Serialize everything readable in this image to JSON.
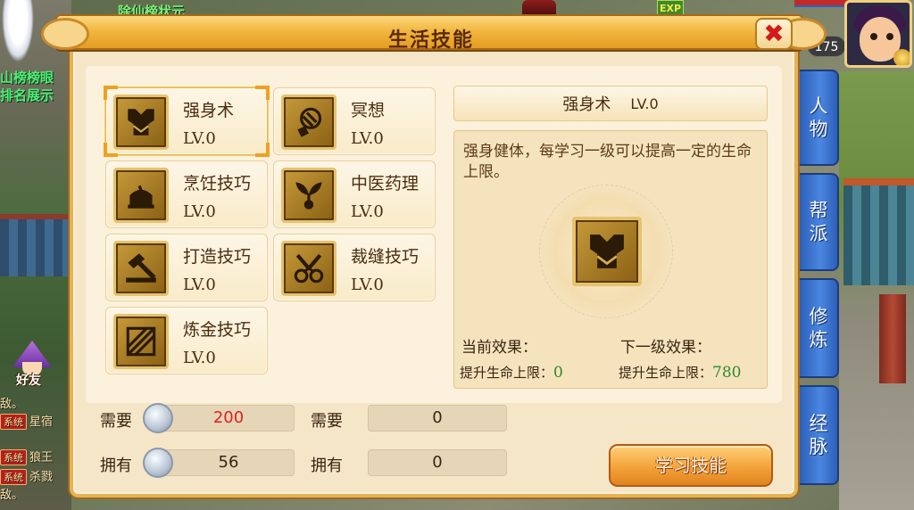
{
  "scene": {
    "top_banner": "除仙榜状元",
    "left_label_1": "山榜榜眼",
    "left_label_2": "排名展示",
    "friend_label": "好友",
    "exp_label": "EXP",
    "player_level": "175",
    "chat": [
      {
        "tag": "",
        "text": "敌。"
      },
      {
        "tag": "系统",
        "text": "星宿"
      },
      {
        "tag": "系统",
        "text": "狼王"
      },
      {
        "tag": "系统",
        "text": "杀戮"
      },
      {
        "tag": "",
        "text": "敌。"
      }
    ]
  },
  "side_tabs": [
    {
      "label": "人物"
    },
    {
      "label": "帮派"
    },
    {
      "label": "修炼"
    },
    {
      "label": "经脉"
    }
  ],
  "dialog": {
    "title": "生活技能",
    "close_label": "✖"
  },
  "skills": [
    {
      "name": "强身术",
      "level": "LV.0",
      "icon": "armor-icon",
      "selected": true
    },
    {
      "name": "冥想",
      "level": "LV.0",
      "icon": "meditation-icon",
      "selected": false
    },
    {
      "name": "烹饪技巧",
      "level": "LV.0",
      "icon": "cooking-icon",
      "selected": false
    },
    {
      "name": "中医药理",
      "level": "LV.0",
      "icon": "herb-icon",
      "selected": false
    },
    {
      "name": "打造技巧",
      "level": "LV.0",
      "icon": "hammer-icon",
      "selected": false
    },
    {
      "name": "裁缝技巧",
      "level": "LV.0",
      "icon": "scissors-icon",
      "selected": false
    },
    {
      "name": "炼金技巧",
      "level": "LV.0",
      "icon": "alchemy-icon",
      "selected": false
    }
  ],
  "detail": {
    "name": "强身术",
    "level": "LV.0",
    "description": "强身健体，每学习一级可以提高一定的生命上限。",
    "current_title": "当前效果：",
    "next_title": "下一级效果：",
    "current_label": "提升生命上限：",
    "current_value": "0",
    "next_label": "提升生命上限：",
    "next_value": "780"
  },
  "resources": {
    "need_label": "需要",
    "own_label": "拥有",
    "need_value_1": "200",
    "own_value_1": "56",
    "need_value_2": "0",
    "own_value_2": "0"
  },
  "learn_button": "学习技能",
  "colors": {
    "panel_bg": "#f6e6c8",
    "title_bar": "#f2b640",
    "need_value_red": "#e02020",
    "effect_green": "#2d8a2d",
    "side_tab_blue": "#4a86e0"
  }
}
